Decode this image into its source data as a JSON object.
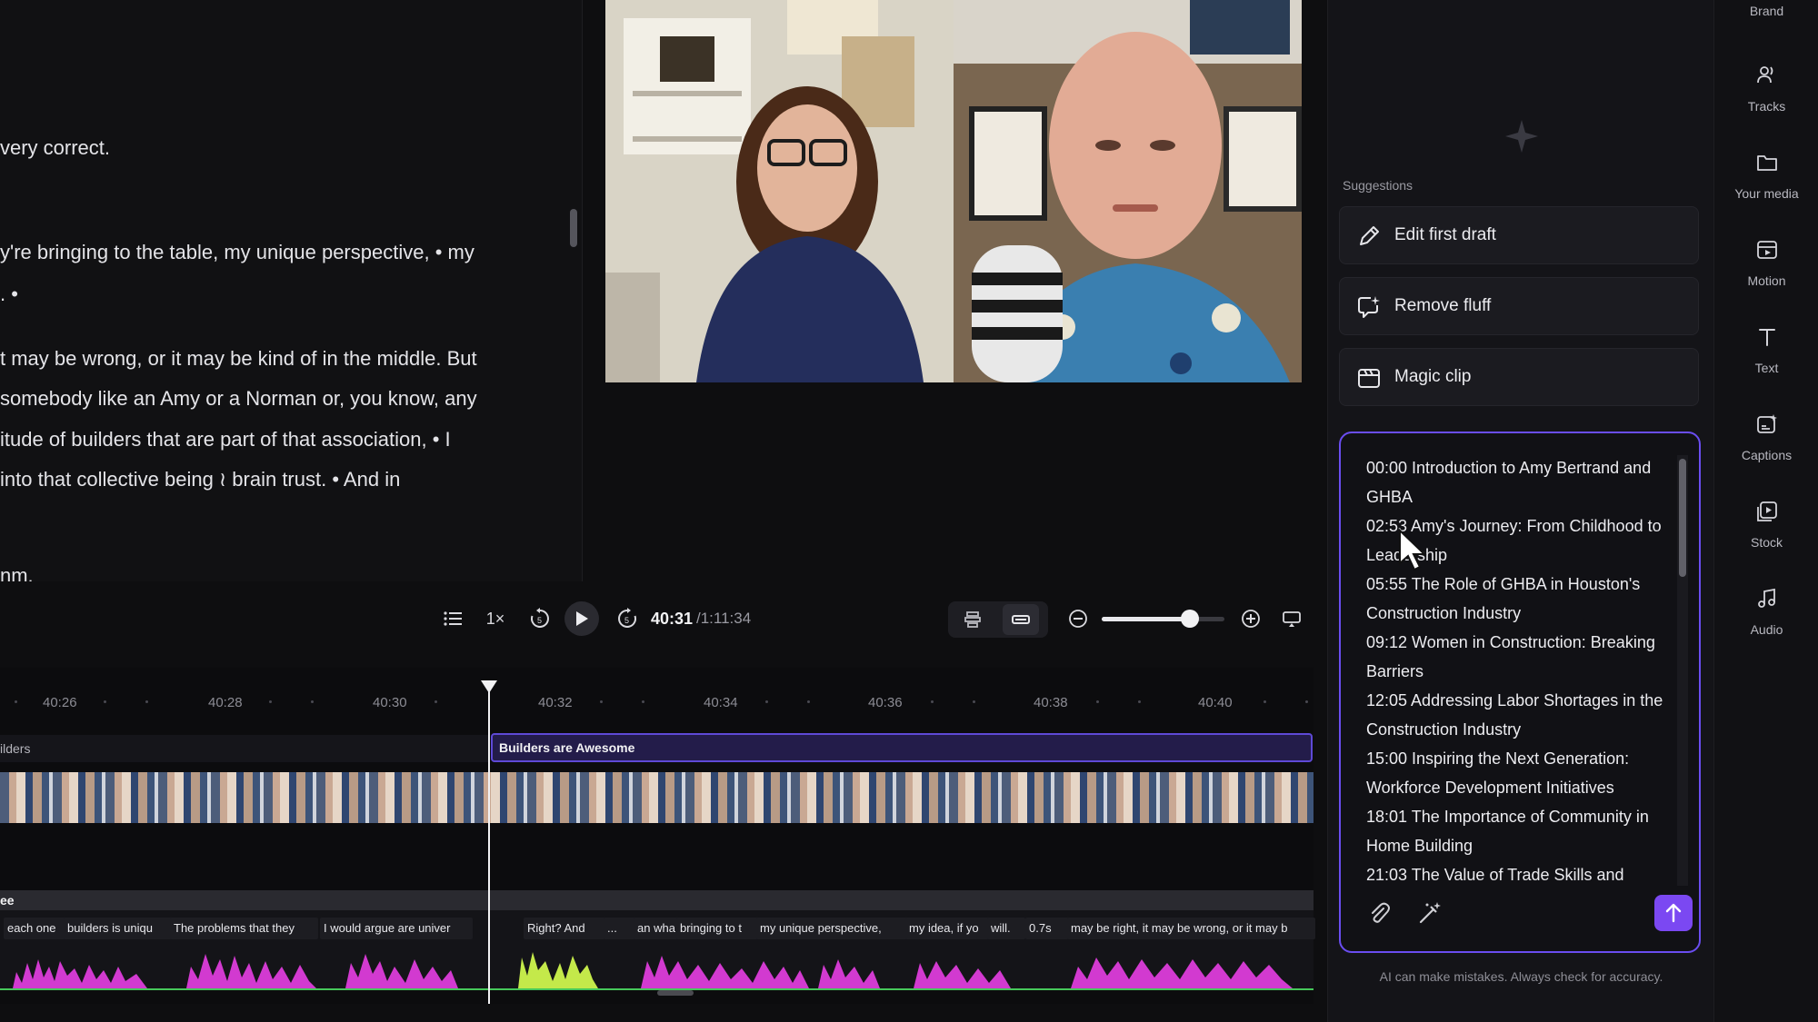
{
  "transcript": {
    "lines": [
      "very correct.",
      "y're bringing to the table, my unique perspective, • my",
      ". •",
      "t may be wrong, or it may be kind of in the middle. But",
      " somebody like an Amy or a Norman or, you know, any",
      "itude of builders that are part of that association, • I",
      " into that collective being ≀ brain trust. • And in",
      "nm."
    ]
  },
  "player": {
    "speed": "1×",
    "current_time": "40:31",
    "total_time": "/1:11:34",
    "zoom_level": 0.72
  },
  "timeline": {
    "ticks": [
      "40:26",
      "40:28",
      "40:30",
      "40:32",
      "40:34",
      "40:36",
      "40:38",
      "40:40"
    ],
    "prev_clip_label": "ilders",
    "clip_label": "Builders are Awesome",
    "audio_track_name": "ee",
    "captions": [
      "each one",
      "builders is uniqu",
      "The problems that they",
      "I would argue are univer",
      "Right? And",
      "...",
      "an wha",
      "bringing to t",
      "my unique perspective,",
      "my idea, if yo",
      "will.",
      "0.7s",
      "may be right, it may be wrong, or it may b"
    ]
  },
  "ai_panel": {
    "suggestions_label": "Suggestions",
    "suggestions": [
      {
        "label": "Edit first draft",
        "icon": "pencil-icon"
      },
      {
        "label": "Remove fluff",
        "icon": "sparkle-chat-icon"
      },
      {
        "label": "Magic clip",
        "icon": "clip-icon"
      }
    ],
    "chapters": [
      "00:00 Introduction to Amy Bertrand and GHBA",
      "02:53 Amy's Journey: From Childhood to Leadership",
      "05:55 The Role of GHBA in Houston's Construction Industry",
      "09:12 Women in Construction: Breaking Barriers",
      "12:05 Addressing Labor Shortages in the Construction Industry",
      "15:00 Inspiring the Next Generation: Workforce Development Initiatives",
      "18:01 The Importance of Community in Home Building",
      "21:03 The Value of Trade Skills and"
    ],
    "disclaimer": "AI can make mistakes. Always check for accuracy.",
    "accent_color": "#7b48f2"
  },
  "rail": {
    "items": [
      {
        "label": "Brand",
        "icon": "brand-icon"
      },
      {
        "label": "Tracks",
        "icon": "tracks-icon"
      },
      {
        "label": "Your media",
        "icon": "folder-icon"
      },
      {
        "label": "Motion",
        "icon": "motion-icon"
      },
      {
        "label": "Text",
        "icon": "text-icon"
      },
      {
        "label": "Captions",
        "icon": "captions-icon"
      },
      {
        "label": "Stock",
        "icon": "stock-icon"
      },
      {
        "label": "Audio",
        "icon": "music-note-icon"
      }
    ]
  }
}
